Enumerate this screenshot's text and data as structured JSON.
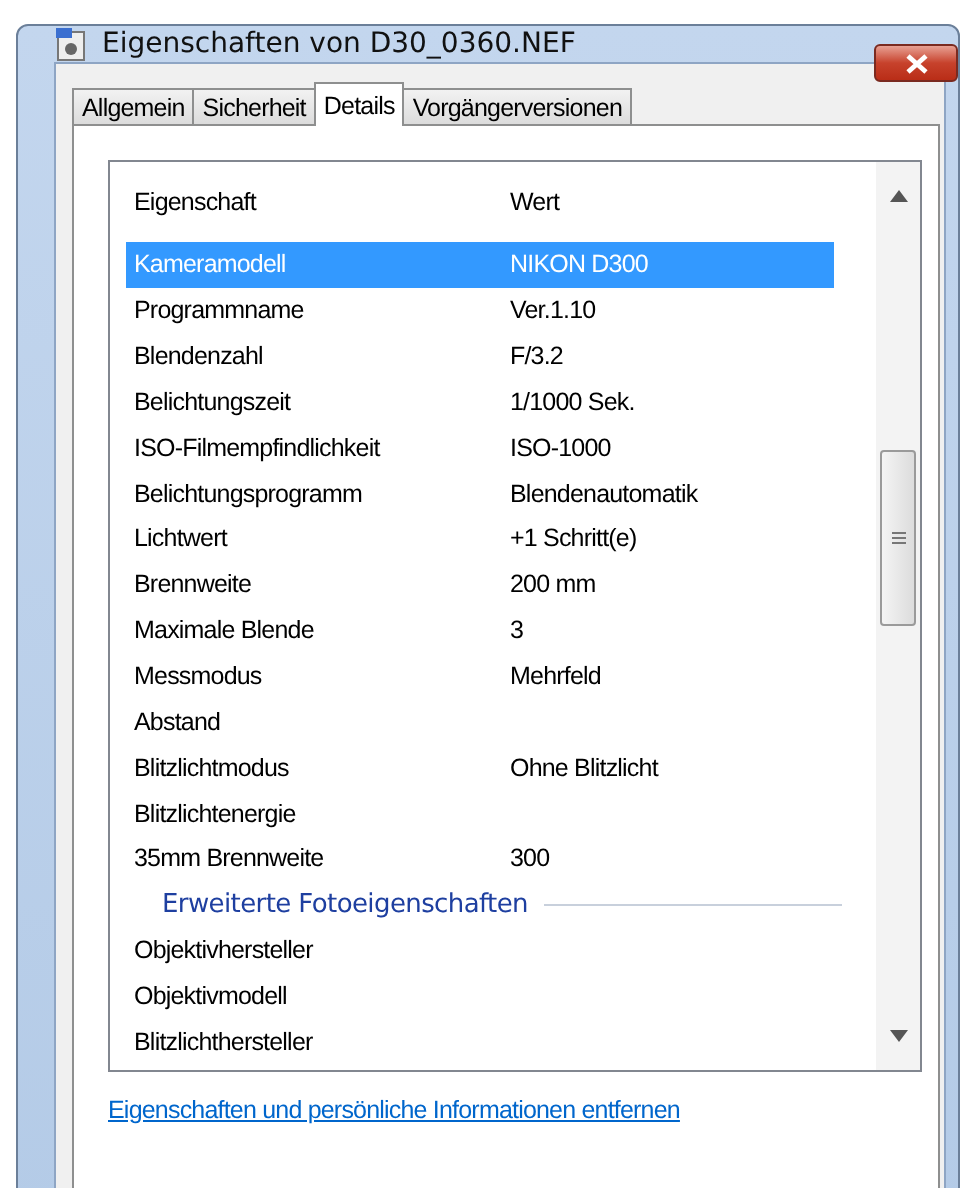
{
  "window": {
    "title": "Eigenschaften von D30_0360.NEF"
  },
  "tabs": [
    {
      "label": "Allgemein",
      "selected": false
    },
    {
      "label": "Sicherheit",
      "selected": false
    },
    {
      "label": "Details",
      "selected": true
    },
    {
      "label": "Vorgängerversionen",
      "selected": false
    }
  ],
  "table": {
    "columns": [
      "Eigenschaft",
      "Wert"
    ],
    "rows": [
      {
        "kind": "row",
        "property": "Kameramodell",
        "value": "NIKON D300",
        "selected": true
      },
      {
        "kind": "row",
        "property": "Programmname",
        "value": "Ver.1.10",
        "selected": false
      },
      {
        "kind": "row",
        "property": "Blendenzahl",
        "value": "F/3.2",
        "selected": false
      },
      {
        "kind": "row",
        "property": "Belichtungszeit",
        "value": "1/1000 Sek.",
        "selected": false
      },
      {
        "kind": "row",
        "property": "ISO-Filmempfindlichkeit",
        "value": "ISO-1000",
        "selected": false
      },
      {
        "kind": "row",
        "property": "Belichtungsprogramm",
        "value": "Blendenautomatik",
        "selected": false
      },
      {
        "kind": "row",
        "property": "Lichtwert",
        "value": "+1 Schritt(e)",
        "selected": false
      },
      {
        "kind": "row",
        "property": "Brennweite",
        "value": "200 mm",
        "selected": false
      },
      {
        "kind": "row",
        "property": "Maximale Blende",
        "value": "3",
        "selected": false
      },
      {
        "kind": "row",
        "property": "Messmodus",
        "value": "Mehrfeld",
        "selected": false
      },
      {
        "kind": "row",
        "property": "Abstand",
        "selected": false
      },
      {
        "kind": "row",
        "property": "Blitzlichtmodus",
        "value": "Ohne Blitzlicht",
        "selected": false
      },
      {
        "kind": "row",
        "property": "Blitzlichtenergie",
        "selected": false
      },
      {
        "kind": "row",
        "property": "35mm Brennweite",
        "value": "300",
        "selected": false
      },
      {
        "kind": "group",
        "property": "Erweiterte Fotoeigenschaften"
      },
      {
        "kind": "row",
        "property": "Objektivhersteller",
        "selected": false
      },
      {
        "kind": "row",
        "property": "Objektivmodell",
        "selected": false
      },
      {
        "kind": "row",
        "property": "Blitzlichthersteller",
        "selected": false
      }
    ]
  },
  "link": "Eigenschaften und persönliche Informationen entfernen"
}
